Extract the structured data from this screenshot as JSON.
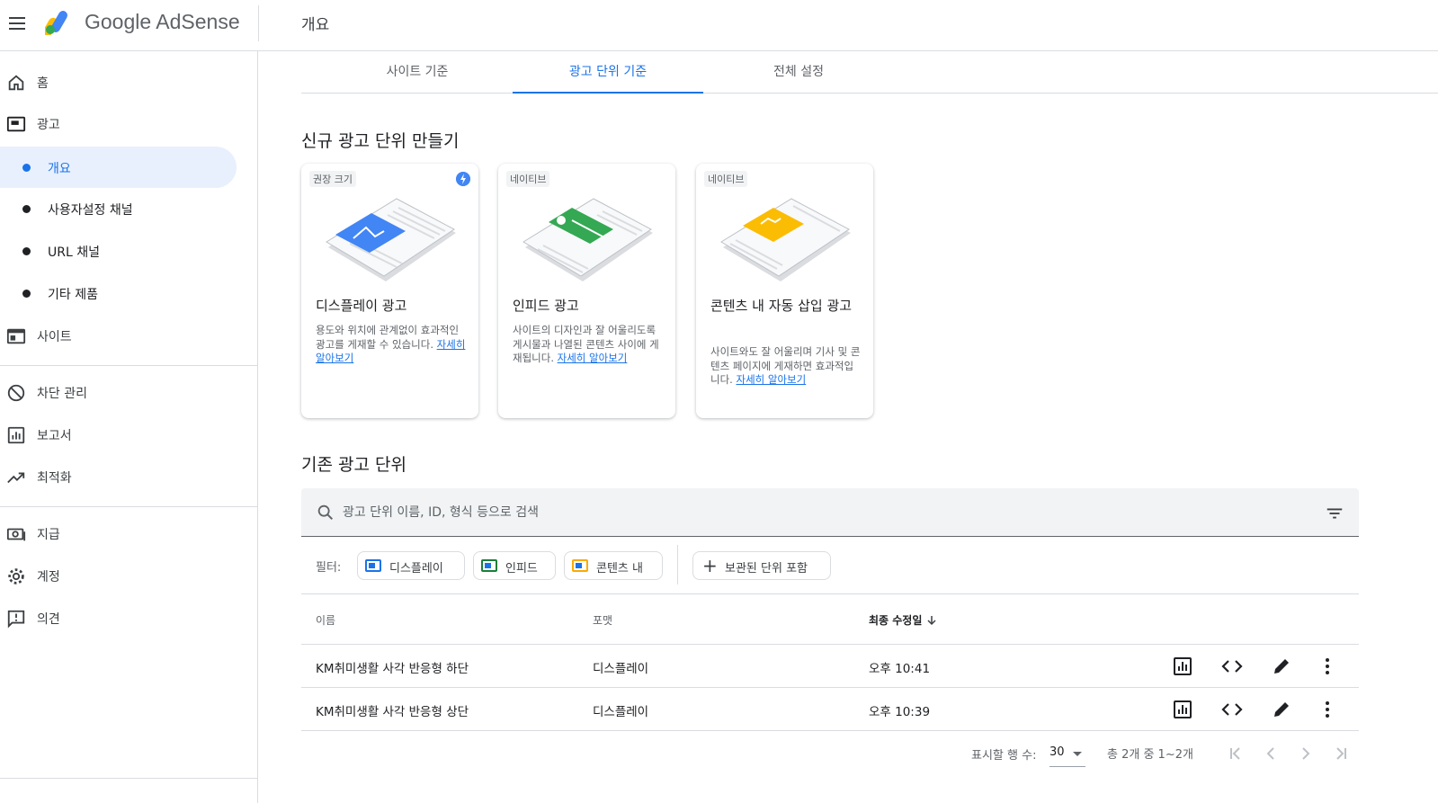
{
  "header": {
    "brand": "Google AdSense",
    "page_title": "개요"
  },
  "sidebar": {
    "items": [
      {
        "label": "홈",
        "icon": "home-icon"
      },
      {
        "label": "광고",
        "icon": "ads-icon"
      },
      {
        "label": "사이트",
        "icon": "sites-icon"
      },
      {
        "label": "차단 관리",
        "icon": "block-icon"
      },
      {
        "label": "보고서",
        "icon": "reports-icon"
      },
      {
        "label": "최적화",
        "icon": "trending-up-icon"
      },
      {
        "label": "지급",
        "icon": "payments-icon"
      },
      {
        "label": "계정",
        "icon": "gear-icon"
      },
      {
        "label": "의견",
        "icon": "feedback-icon"
      }
    ],
    "ads_subitems": [
      {
        "label": "개요",
        "active": true
      },
      {
        "label": "사용자설정 채널",
        "active": false
      },
      {
        "label": "URL 채널",
        "active": false
      },
      {
        "label": "기타 제품",
        "active": false
      }
    ]
  },
  "tabs": [
    {
      "label": "사이트 기준",
      "active": false
    },
    {
      "label": "광고 단위 기준",
      "active": true
    },
    {
      "label": "전체 설정",
      "active": false
    }
  ],
  "create_section": {
    "title": "신규 광고 단위 만들기",
    "cards": [
      {
        "tag": "권장 크기",
        "title": "디스플레이 광고",
        "desc": "용도와 위치에 관계없이 효과적인 광고를 게재할 수 있습니다. ",
        "link": "자세히 알아보기",
        "accent": "#4285f4"
      },
      {
        "tag": "네이티브",
        "title": "인피드 광고",
        "desc": "사이트의 디자인과 잘 어울리도록 게시물과 나열된 콘텐츠 사이에 게재됩니다. ",
        "link": "자세히 알아보기",
        "accent": "#34a853"
      },
      {
        "tag": "네이티브",
        "title": "콘텐츠 내 자동 삽입 광고",
        "desc": "사이트와도 잘 어울리며 기사 및 콘텐츠 페이지에 게재하면 효과적입니다. ",
        "link": "자세히 알아보기",
        "accent": "#fbbc04"
      }
    ]
  },
  "existing_section": {
    "title": "기존 광고 단위",
    "search_placeholder": "광고 단위 이름, ID, 형식 등으로 검색",
    "filter_label": "필터:",
    "filter_chips": [
      {
        "label": "디스플레이",
        "color": "#1a73e8"
      },
      {
        "label": "인피드",
        "color": "#188038"
      },
      {
        "label": "콘텐츠 내",
        "color": "#f9ab00"
      }
    ],
    "archived_chip": "보관된 단위 포함",
    "columns": [
      "이름",
      "포맷",
      "최종 수정일"
    ],
    "rows": [
      {
        "name": "KM취미생활 사각 반응형 하단",
        "format": "디스플레이",
        "modified": "오후 10:41"
      },
      {
        "name": "KM취미생활 사각 반응형 상단",
        "format": "디스플레이",
        "modified": "오후 10:39"
      }
    ],
    "pagination": {
      "rows_label": "표시할 행 수:",
      "rows_value": "30",
      "range": "총 2개 중 1~2개"
    }
  },
  "colors": {
    "accent": "#1a73e8",
    "active_bg": "#e8f0fe"
  }
}
